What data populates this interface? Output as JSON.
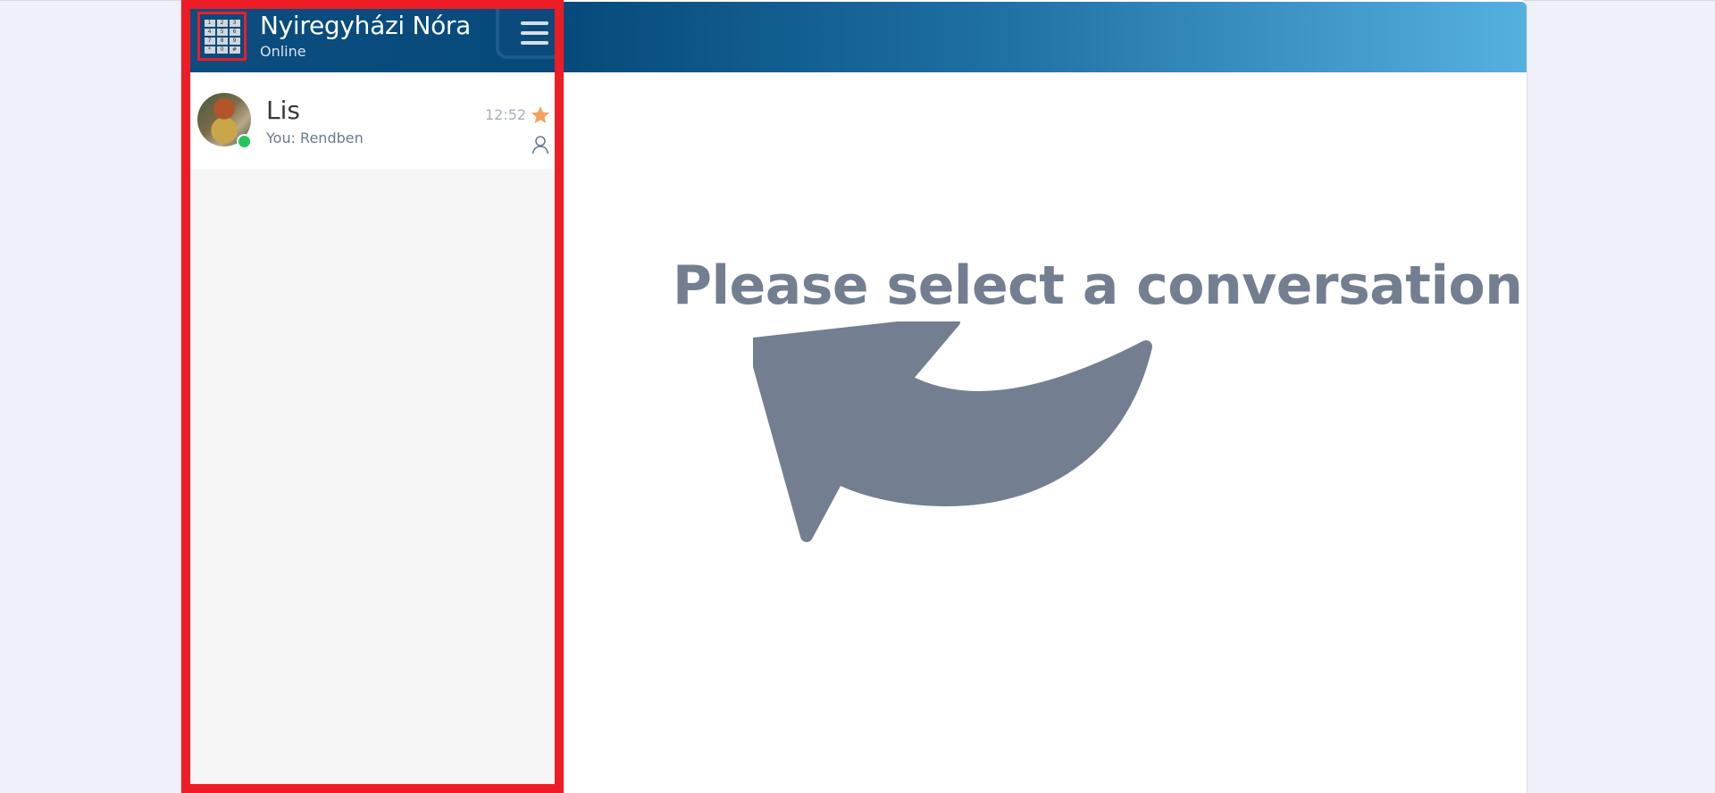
{
  "sidebar": {
    "header": {
      "user_name": "Nyiregyházi Nóra",
      "user_status": "Online",
      "logo_keys": [
        "1",
        "2",
        "3",
        "4",
        "5",
        "6",
        "7",
        "8",
        "9",
        "*",
        "0",
        "#"
      ],
      "logo_icon": "keypad-logo-icon",
      "menu_icon": "hamburger-menu-icon"
    },
    "conversations": [
      {
        "name": "Lis",
        "preview": "You: Rendben",
        "time": "12:52",
        "online": true,
        "starred": true,
        "icons": [
          "avatar",
          "star-icon",
          "person-icon"
        ]
      }
    ]
  },
  "main": {
    "empty_state_text": "Please select a conversation",
    "empty_state_icon": "curved-arrow-icon"
  },
  "colors": {
    "header_dark": "#054a7b",
    "header_light": "#55b0e0",
    "highlight_border": "#ee1c25",
    "online": "#22c55e",
    "star": "#f4a261",
    "muted_text": "#737f91"
  }
}
